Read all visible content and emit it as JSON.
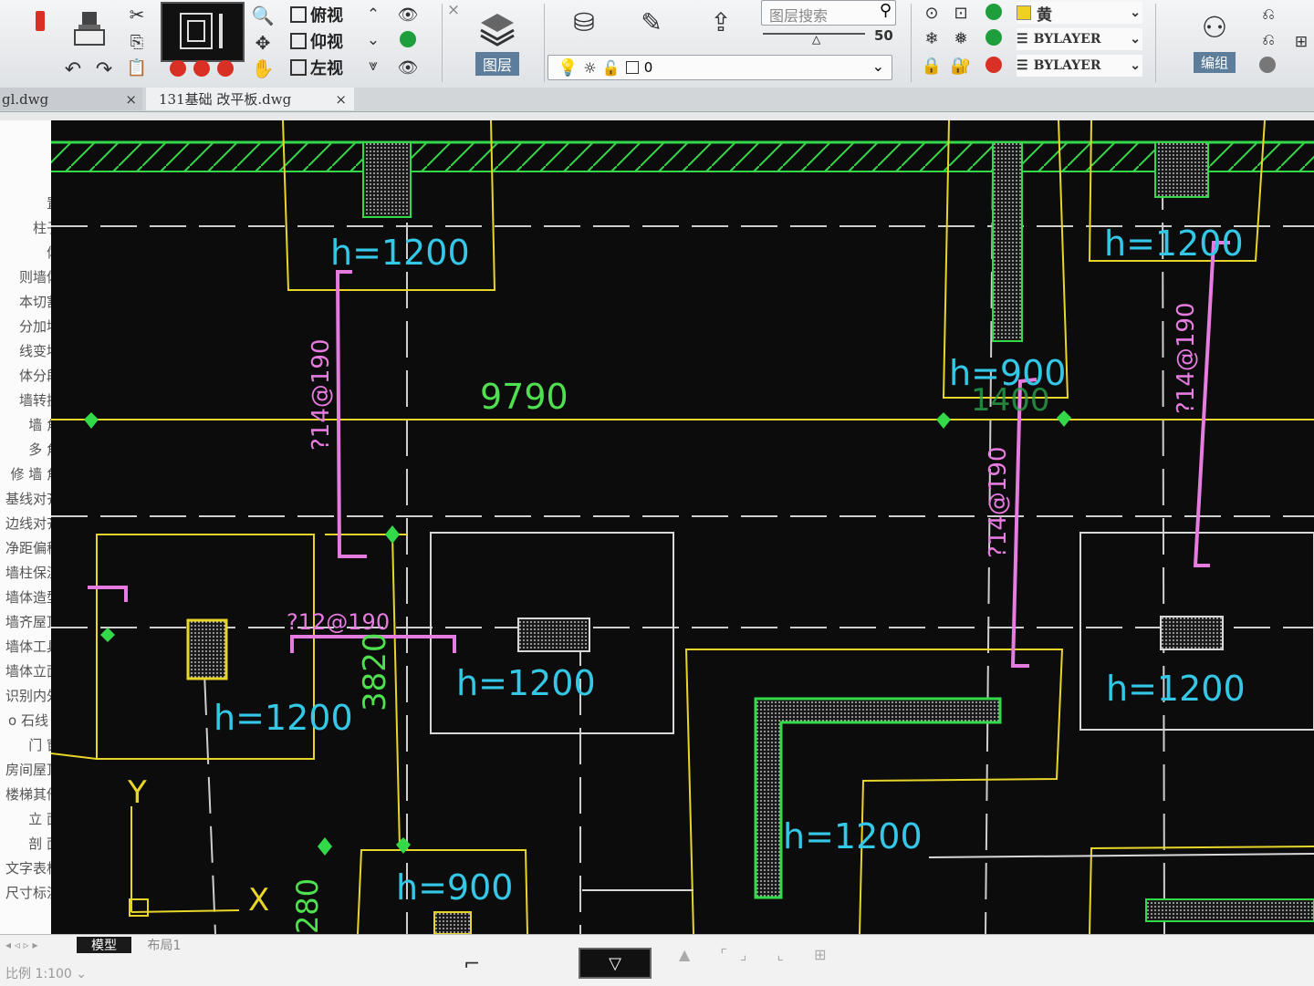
{
  "ribbon": {
    "views": [
      {
        "label": "俯视",
        "icon": "top-view-icon"
      },
      {
        "label": "仰视",
        "icon": "bottom-view-icon"
      },
      {
        "label": "左视",
        "icon": "left-view-icon"
      }
    ],
    "layer_button": "图层",
    "layer_search_placeholder": "图层搜索",
    "slider_value": "50",
    "current_layer": "0",
    "color_value": "黄",
    "linetype_value": "BYLAYER",
    "lineweight_value": "BYLAYER",
    "group_button": "编组"
  },
  "file_tabs": [
    {
      "label": "gl.dwg"
    },
    {
      "label": "131基础 改平板.dwg"
    }
  ],
  "sidebar": {
    "items": [
      "置",
      "柱子",
      "体",
      "则墙体",
      "本切割",
      "分加墙",
      "线变墙",
      "体分段",
      "墙转换",
      "墙 角",
      "多 角",
      "修 墙 角",
      "基线对齐",
      "边线对齐",
      "净距偏移",
      "墙柱保温",
      "墙体造型",
      "墙齐屋顶",
      "墙体工具",
      "墙体立面",
      "识别内外",
      "o 石线 c",
      "门  窗",
      "房间屋顶",
      "楼梯其他",
      "立  面",
      "剖  面",
      "文字表格",
      "尺寸标注"
    ]
  },
  "drawing": {
    "dimensions": [
      "9790",
      "3820",
      "280"
    ],
    "rebar_labels": [
      "?14@190",
      "?14@190",
      "?14@190",
      "?12@190"
    ],
    "height_labels": [
      "h=1200",
      "h=1200",
      "h=900",
      "h=1200",
      "h=1200",
      "h=1200",
      "h=1200",
      "h=900"
    ],
    "overlap_text": "1400",
    "ucs_axes": {
      "y": "Y",
      "x": "X"
    }
  },
  "bottom": {
    "tab_model": "模型",
    "tab_layout": "布局1",
    "scale_label": "比例 1:100"
  },
  "colors": {
    "canvas_bg": "#0c0c0d",
    "yellow_outline": "#e8d52a",
    "white_line": "#d8d8d8",
    "green_hatch": "#34d94a",
    "magenta_rebar": "#e67be0",
    "cyan_text": "#35c8e6",
    "green_text": "#4fe04f"
  }
}
